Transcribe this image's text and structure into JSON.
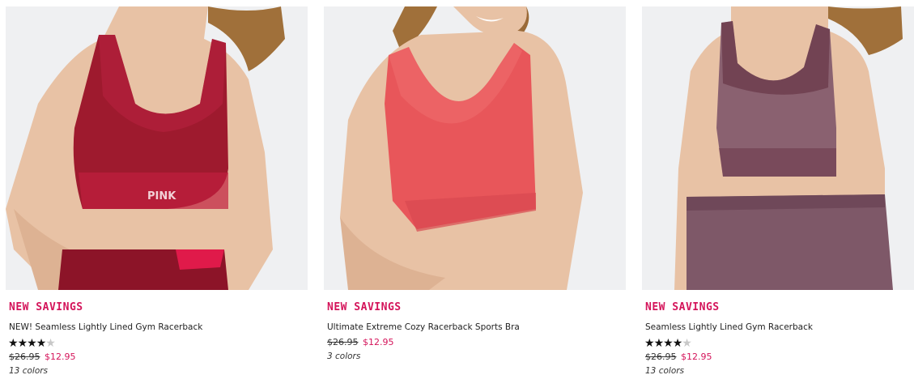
{
  "products": [
    {
      "badge": "NEW SAVINGS",
      "name": "NEW! Seamless Lightly Lined Gym Racerback",
      "rating": 4,
      "rating_max": 5,
      "rating_shown": true,
      "price_was": "$26.95",
      "price_now": "$12.95",
      "colors": "13 colors",
      "bra_color": "#9e1a2e",
      "bra_trim": "#e01a4a",
      "logo": "PINK"
    },
    {
      "badge": "NEW SAVINGS",
      "name": "Ultimate Extreme Cozy Racerback Sports Bra",
      "rating_shown": false,
      "price_was": "$26.95",
      "price_now": "$12.95",
      "colors": "3 colors",
      "bra_color": "#e8565a",
      "bra_trim": "#e8565a"
    },
    {
      "badge": "NEW SAVINGS",
      "name": "Seamless Lightly Lined Gym Racerback",
      "rating": 4,
      "rating_max": 5,
      "rating_shown": true,
      "price_was": "$26.95",
      "price_now": "$12.95",
      "colors": "13 colors",
      "bra_color": "#8a6170",
      "bra_trim": "#5e2c3c"
    }
  ]
}
